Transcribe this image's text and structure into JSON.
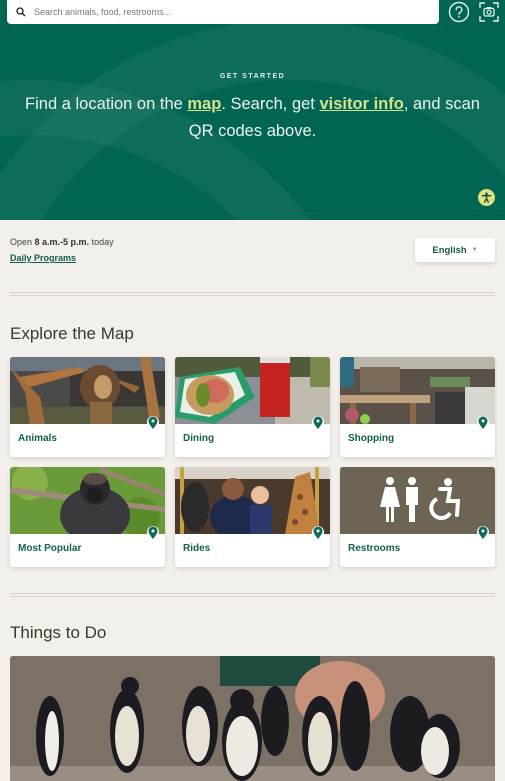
{
  "search": {
    "placeholder": "Search animals, food, restrooms...",
    "icon": "search-icon"
  },
  "topbar": {
    "help_icon": "help-circle-icon",
    "scan_icon": "qr-camera-scan-icon"
  },
  "hero": {
    "eyebrow": "GET STARTED",
    "text_before_map": "Find a location on the ",
    "map_link": "map",
    "text_middle": ". Search, get ",
    "visitor_link": "visitor info",
    "text_after": ", and scan QR codes above.",
    "accessibility_icon": "accessibility-icon"
  },
  "info": {
    "hours_prefix": "Open ",
    "hours": "8 a.m.-5 p.m.",
    "hours_suffix": " today",
    "programs_link": "Daily Programs",
    "language": "English",
    "language_caret": "▼"
  },
  "explore": {
    "title": "Explore the Map",
    "cards": [
      {
        "label": "Animals",
        "image": "lion"
      },
      {
        "label": "Dining",
        "image": "hot-dog"
      },
      {
        "label": "Shopping",
        "image": "gift-shop"
      },
      {
        "label": "Most Popular",
        "image": "gorilla"
      },
      {
        "label": "Rides",
        "image": "carousel"
      },
      {
        "label": "Restrooms",
        "image": "restroom-signs"
      }
    ]
  },
  "things": {
    "title": "Things to Do",
    "image": "penguins"
  },
  "colors": {
    "brand_green": "#006553",
    "link_yellow": "#d8e08a",
    "label_green": "#155f4e",
    "background": "#f3f0eb"
  }
}
